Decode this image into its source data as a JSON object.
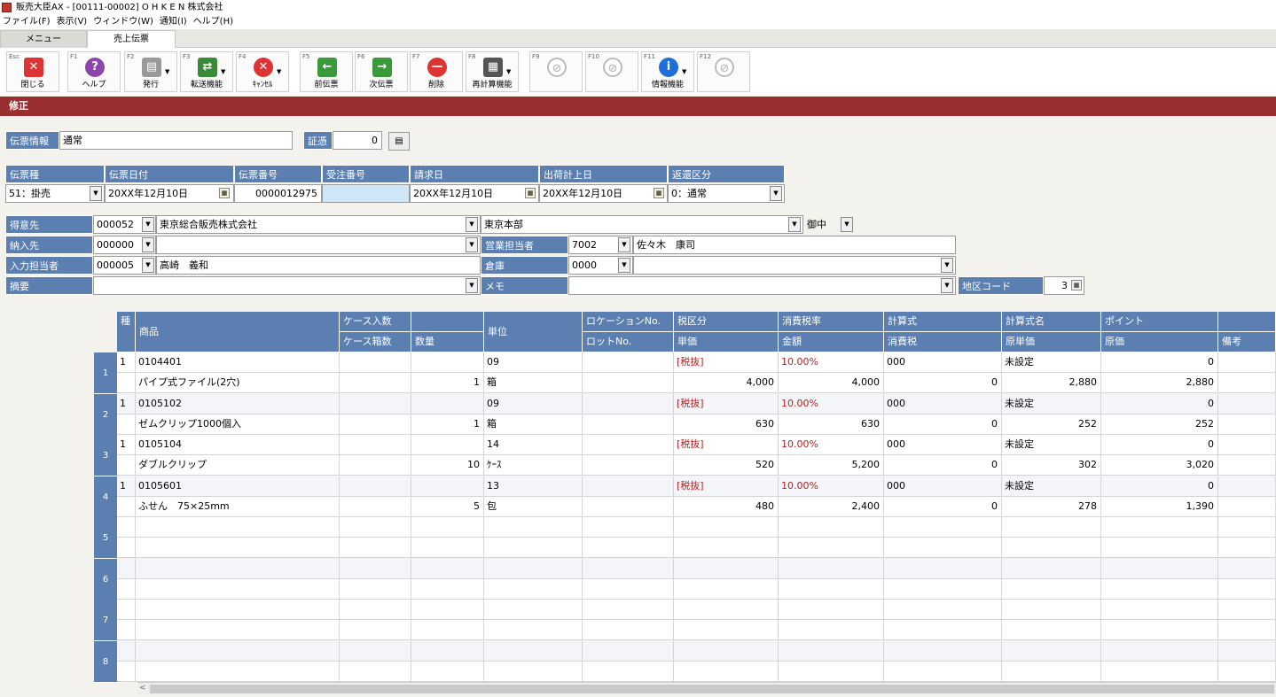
{
  "window_title": "販売大臣AX - [00111-00002] O H K E N 株式会社",
  "menu": [
    "ファイル(F)",
    "表示(V)",
    "ウィンドウ(W)",
    "通知(I)",
    "ヘルプ(H)"
  ],
  "tabs": [
    "メニュー",
    "売上伝票"
  ],
  "toolbar": [
    {
      "fk": "Esc",
      "label": "閉じる",
      "icon": "close-window-icon"
    },
    {
      "fk": "F1",
      "label": "ヘルプ",
      "icon": "help-icon"
    },
    {
      "fk": "F2",
      "label": "発行",
      "icon": "printer-icon"
    },
    {
      "fk": "F3",
      "label": "転送機能",
      "icon": "transfer-icon"
    },
    {
      "fk": "F4",
      "label": "ｷｬﾝｾﾙ",
      "icon": "cancel-icon"
    },
    {
      "fk": "F5",
      "label": "前伝票",
      "icon": "arrow-left-icon"
    },
    {
      "fk": "F6",
      "label": "次伝票",
      "icon": "arrow-right-icon"
    },
    {
      "fk": "F7",
      "label": "削除",
      "icon": "delete-icon"
    },
    {
      "fk": "F8",
      "label": "再計算機能",
      "icon": "calculator-icon"
    },
    {
      "fk": "F9",
      "label": "",
      "icon": "disabled-icon"
    },
    {
      "fk": "F10",
      "label": "",
      "icon": "disabled-icon"
    },
    {
      "fk": "F11",
      "label": "情報機能",
      "icon": "info-icon"
    },
    {
      "fk": "F12",
      "label": "",
      "icon": "disabled-icon"
    }
  ],
  "mode_label": "修正",
  "voucher_info": {
    "label": "伝票情報",
    "value": "通常",
    "proof_label": "証憑",
    "proof_value": "0"
  },
  "header": {
    "labels": [
      "伝票種",
      "伝票日付",
      "伝票番号",
      "受注番号",
      "請求日",
      "出荷計上日",
      "返還区分"
    ],
    "type": "51：掛売",
    "date": "20XX年12月10日",
    "number": "0000012975",
    "order": "",
    "bill_date": "20XX年12月10日",
    "ship_date": "20XX年12月10日",
    "return_type": "0：通常"
  },
  "party": {
    "customer_label": "得意先",
    "customer_code": "000052",
    "customer_name": "東京総合販売株式会社",
    "branch": "東京本部",
    "honorific": "御中",
    "delivery_label": "納入先",
    "delivery_code": "000000",
    "delivery_name": "",
    "sales_rep_label": "営業担当者",
    "sales_rep_code": "7002",
    "sales_rep_name": "佐々木　康司",
    "entry_label": "入力担当者",
    "entry_code": "000005",
    "entry_name": "高崎　義和",
    "warehouse_label": "倉庫",
    "warehouse_code": "0000",
    "warehouse_name": "",
    "summary_label": "摘要",
    "summary": "",
    "memo_label": "メモ",
    "memo": "",
    "region_label": "地区コード",
    "region_value": "3"
  },
  "grid": {
    "headers_top": [
      "種",
      "商品",
      "ケース入数",
      "",
      "単位",
      "ロケーションNo.",
      "税区分",
      "消費税率",
      "計算式",
      "計算式名",
      "ポイント",
      ""
    ],
    "headers_bottom": [
      "",
      "",
      "ケース箱数",
      "数量",
      "",
      "ロットNo.",
      "単価",
      "金額",
      "消費税",
      "原単価",
      "原価",
      "備考"
    ],
    "rows": [
      {
        "no": "1",
        "kind": "1",
        "code": "0104401",
        "name": "パイプ式ファイル(2穴)",
        "case_qty": "",
        "case_box": "",
        "qty": "1",
        "unit_code": "09",
        "unit": "箱",
        "tax": "[税抜]",
        "rate": "10.00%",
        "price": "4,000",
        "amount": "4,000",
        "formula": "000",
        "tax_amt": "0",
        "formula_name": "未設定",
        "cost_unit": "2,880",
        "point": "0",
        "cost": "2,880"
      },
      {
        "no": "2",
        "kind": "1",
        "code": "0105102",
        "name": "ゼムクリップ1000個入",
        "case_qty": "",
        "case_box": "",
        "qty": "1",
        "unit_code": "09",
        "unit": "箱",
        "tax": "[税抜]",
        "rate": "10.00%",
        "price": "630",
        "amount": "630",
        "formula": "000",
        "tax_amt": "0",
        "formula_name": "未設定",
        "cost_unit": "252",
        "point": "0",
        "cost": "252"
      },
      {
        "no": "3",
        "kind": "1",
        "code": "0105104",
        "name": "ダブルクリップ",
        "case_qty": "",
        "case_box": "",
        "qty": "10",
        "unit_code": "14",
        "unit": "ｹｰｽ",
        "tax": "[税抜]",
        "rate": "10.00%",
        "price": "520",
        "amount": "5,200",
        "formula": "000",
        "tax_amt": "0",
        "formula_name": "未設定",
        "cost_unit": "302",
        "point": "0",
        "cost": "3,020"
      },
      {
        "no": "4",
        "kind": "1",
        "code": "0105601",
        "name": "ふせん　75×25mm",
        "case_qty": "",
        "case_box": "",
        "qty": "5",
        "unit_code": "13",
        "unit": "包",
        "tax": "[税抜]",
        "rate": "10.00%",
        "price": "480",
        "amount": "2,400",
        "formula": "000",
        "tax_amt": "0",
        "formula_name": "未設定",
        "cost_unit": "278",
        "point": "0",
        "cost": "1,390"
      },
      {
        "no": "5"
      },
      {
        "no": "6"
      },
      {
        "no": "7"
      },
      {
        "no": "8"
      }
    ]
  }
}
